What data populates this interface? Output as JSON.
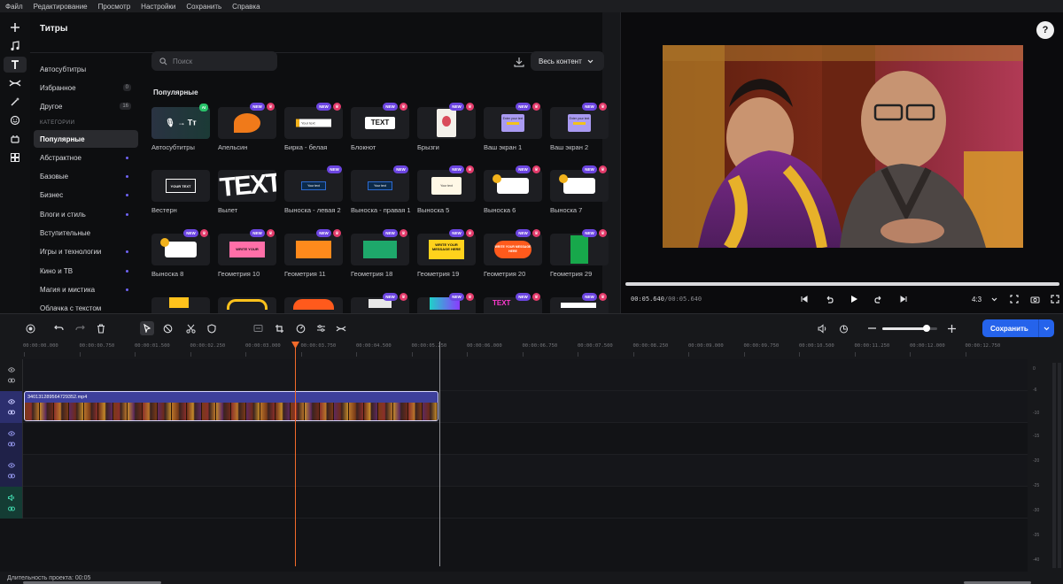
{
  "menu": [
    "Файл",
    "Редактирование",
    "Просмотр",
    "Настройки",
    "Сохранить",
    "Справка"
  ],
  "rail": [
    "plus-icon",
    "music-icon",
    "text-icon",
    "transition-icon",
    "effects-icon",
    "sticker-icon",
    "plugin-icon",
    "more-tools-icon"
  ],
  "panel": {
    "title": "Титры",
    "search_placeholder": "Поиск",
    "filter": "Весь контент",
    "section_title": "Популярные"
  },
  "sidebar": {
    "top_items": [
      {
        "label": "Автосубтитры",
        "badge": ""
      },
      {
        "label": "Избранное",
        "badge": "0"
      },
      {
        "label": "Другое",
        "badge": "16"
      }
    ],
    "categories_heading": "КАТЕГОРИИ",
    "categories": [
      {
        "label": "Популярные",
        "selected": true,
        "dot": false
      },
      {
        "label": "Абстрактное",
        "selected": false,
        "dot": true
      },
      {
        "label": "Базовые",
        "selected": false,
        "dot": true
      },
      {
        "label": "Бизнес",
        "selected": false,
        "dot": true
      },
      {
        "label": "Влоги и стиль",
        "selected": false,
        "dot": true
      },
      {
        "label": "Вступительные",
        "selected": false,
        "dot": false
      },
      {
        "label": "Игры и технологии",
        "selected": false,
        "dot": true
      },
      {
        "label": "Кино и ТВ",
        "selected": false,
        "dot": true
      },
      {
        "label": "Магия и мистика",
        "selected": false,
        "dot": true
      },
      {
        "label": "Облачка с текстом",
        "selected": false,
        "dot": false
      }
    ]
  },
  "tag_text": {
    "new": "NEW",
    "ai": "AI",
    "crown": "♛"
  },
  "tiles": [
    {
      "label": "Автосубтитры",
      "ai": true,
      "new": false,
      "crown": false,
      "thumb": "autosub",
      "thumb_text": "Tт"
    },
    {
      "label": "Апельсин",
      "new": true,
      "crown": true,
      "thumb": "orange",
      "thumb_text": ""
    },
    {
      "label": "Бирка - белая",
      "new": true,
      "crown": true,
      "thumb": "tag",
      "thumb_text": "Your text"
    },
    {
      "label": "Блокнот",
      "new": true,
      "crown": true,
      "thumb": "notepad",
      "thumb_text": "TEXT"
    },
    {
      "label": "Брызги",
      "new": true,
      "crown": true,
      "thumb": "splash",
      "thumb_text": ""
    },
    {
      "label": "Ваш экран 1",
      "new": true,
      "crown": true,
      "thumb": "screen",
      "thumb_text": "Enter your text"
    },
    {
      "label": "Ваш экран 2",
      "new": true,
      "crown": true,
      "thumb": "screen",
      "thumb_text": "Enter your text"
    },
    {
      "label": "Вестерн",
      "new": false,
      "crown": false,
      "thumb": "western",
      "thumb_text": "YOUR TEXT"
    },
    {
      "label": "Вылет",
      "new": false,
      "crown": false,
      "thumb": "bigtext",
      "thumb_text": "TEXT"
    },
    {
      "label": "Выноска - левая 2",
      "new": true,
      "crown": false,
      "thumb": "callout-dark",
      "thumb_text": "Your text"
    },
    {
      "label": "Выноска - правая 1",
      "new": true,
      "crown": false,
      "thumb": "callout-dark2",
      "thumb_text": "Your text"
    },
    {
      "label": "Выноска 5",
      "new": true,
      "crown": true,
      "thumb": "callout-light",
      "thumb_text": "Your text"
    },
    {
      "label": "Выноска 6",
      "new": true,
      "crown": true,
      "thumb": "callout-emoji",
      "thumb_text": ""
    },
    {
      "label": "Выноска 7",
      "new": true,
      "crown": true,
      "thumb": "callout-emoji2",
      "thumb_text": ""
    },
    {
      "label": "Выноска 8",
      "new": true,
      "crown": true,
      "thumb": "callout-emoji3",
      "thumb_text": ""
    },
    {
      "label": "Геометрия 10",
      "new": true,
      "crown": true,
      "thumb": "geo-pink",
      "thumb_text": "WRITE YOUR"
    },
    {
      "label": "Геометрия 11",
      "new": true,
      "crown": true,
      "thumb": "geo-orange",
      "thumb_text": ""
    },
    {
      "label": "Геометрия 18",
      "new": true,
      "crown": true,
      "thumb": "geo-green",
      "thumb_text": ""
    },
    {
      "label": "Геометрия 19",
      "new": true,
      "crown": true,
      "thumb": "geo-yellow",
      "thumb_text": "WRITE YOUR MESSAGE HERE"
    },
    {
      "label": "Геометрия 20",
      "new": true,
      "crown": true,
      "thumb": "geo-red",
      "thumb_text": "WRITE YOUR MESSAGE HERE"
    },
    {
      "label": "Геометрия 29",
      "new": true,
      "crown": true,
      "thumb": "geo-green2",
      "thumb_text": ""
    },
    {
      "label": "",
      "new": false,
      "crown": false,
      "thumb": "partial-yellow",
      "thumb_text": ""
    },
    {
      "label": "",
      "new": false,
      "crown": false,
      "thumb": "partial-yellow2",
      "thumb_text": ""
    },
    {
      "label": "",
      "new": false,
      "crown": false,
      "thumb": "partial-orange",
      "thumb_text": ""
    },
    {
      "label": "",
      "new": true,
      "crown": true,
      "thumb": "partial-white",
      "thumb_text": ""
    },
    {
      "label": "",
      "new": true,
      "crown": true,
      "thumb": "partial-splash",
      "thumb_text": ""
    },
    {
      "label": "",
      "new": true,
      "crown": true,
      "thumb": "partial-text",
      "thumb_text": "TEXT"
    },
    {
      "label": "",
      "new": true,
      "crown": true,
      "thumb": "partial-white2",
      "thumb_text": ""
    }
  ],
  "preview": {
    "time_current": "00:05.640",
    "time_total": "/00:05.640",
    "aspect_ratio": "4:3",
    "progress": 1.0
  },
  "toolbar": {
    "save_label": "Сохранить",
    "zoom_level": 0.8
  },
  "ruler": [
    "00:00:00.000",
    "00:00:00.750",
    "00:00:01.500",
    "00:00:02.250",
    "00:00:03.000",
    "00:00:03.750",
    "00:00:04.500",
    "00:00:05.250",
    "00:00:06.000",
    "00:00:06.750",
    "00:00:07.500",
    "00:00:08.250",
    "00:00:09.000",
    "00:00:09.750",
    "00:00:10.500",
    "00:00:11.250",
    "00:00:12.000",
    "00:00:12.750"
  ],
  "clip": {
    "name": "340131289564729352.mp4"
  },
  "meter_labels": [
    "0",
    "-6",
    "-10",
    "-15",
    "-20",
    "-25",
    "-30",
    "-35",
    "-40",
    "-45",
    "-50",
    "-60"
  ],
  "status": {
    "duration": "Длительность проекта: 00:05"
  },
  "colors": {
    "accent": "#2563eb",
    "clip": "#3d3f9b",
    "playhead": "#f26a2a",
    "new_tag": "#6b45e0",
    "crown": "#e33b6b"
  }
}
